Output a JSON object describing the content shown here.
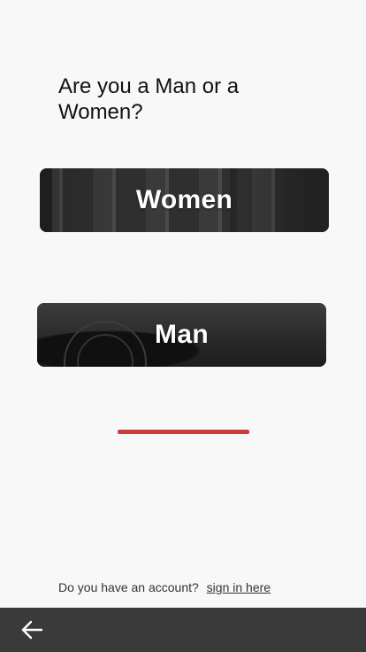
{
  "question": {
    "text": "Are you a Man or a Women?"
  },
  "choices": [
    {
      "label": "Women"
    },
    {
      "label": "Man"
    }
  ],
  "accent_color": "#d03a3f",
  "footer": {
    "prompt": "Do you have an account?",
    "link": "sign in here"
  },
  "nav": {
    "back_icon": "arrow-left-icon"
  }
}
